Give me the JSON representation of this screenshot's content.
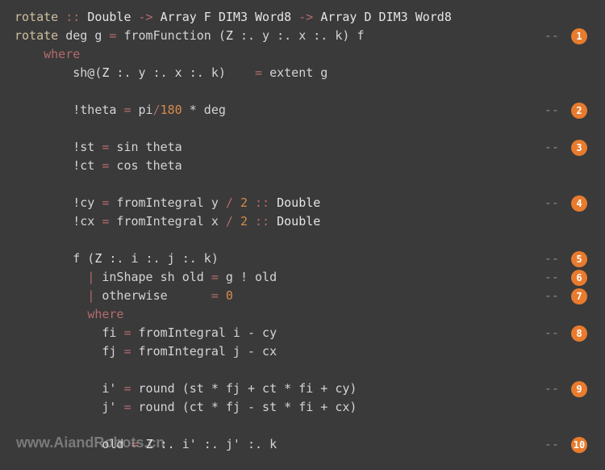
{
  "lines": [
    {
      "tokens": [
        {
          "t": "rotate ",
          "c": "c-fn"
        },
        {
          "t": "::",
          "c": "c-op"
        },
        {
          "t": " ",
          "c": "c-plain"
        },
        {
          "t": "Double",
          "c": "c-type"
        },
        {
          "t": " ",
          "c": "c-plain"
        },
        {
          "t": "->",
          "c": "c-op"
        },
        {
          "t": " ",
          "c": "c-plain"
        },
        {
          "t": "Array F DIM3 Word8",
          "c": "c-type"
        },
        {
          "t": " ",
          "c": "c-plain"
        },
        {
          "t": "->",
          "c": "c-op"
        },
        {
          "t": " ",
          "c": "c-plain"
        },
        {
          "t": "Array D DIM3 Word8",
          "c": "c-type"
        }
      ],
      "marker": null
    },
    {
      "tokens": [
        {
          "t": "rotate",
          "c": "c-fn"
        },
        {
          "t": " deg g ",
          "c": "c-var"
        },
        {
          "t": "=",
          "c": "c-eq"
        },
        {
          "t": " fromFunction (",
          "c": "c-var"
        },
        {
          "t": "Z",
          "c": "c-type"
        },
        {
          "t": " :. y :. x :. k) f",
          "c": "c-var"
        }
      ],
      "marker": "1"
    },
    {
      "tokens": [
        {
          "t": "    ",
          "c": "c-plain"
        },
        {
          "t": "where",
          "c": "c-kw"
        }
      ],
      "marker": null
    },
    {
      "tokens": [
        {
          "t": "        sh@(",
          "c": "c-var"
        },
        {
          "t": "Z",
          "c": "c-type"
        },
        {
          "t": " :. y :. x :. k)    ",
          "c": "c-var"
        },
        {
          "t": "=",
          "c": "c-eq"
        },
        {
          "t": " extent g",
          "c": "c-var"
        }
      ],
      "marker": null
    },
    {
      "tokens": [
        {
          "t": " ",
          "c": "c-plain"
        }
      ],
      "marker": null
    },
    {
      "tokens": [
        {
          "t": "        !theta ",
          "c": "c-var"
        },
        {
          "t": "=",
          "c": "c-eq"
        },
        {
          "t": " pi",
          "c": "c-var"
        },
        {
          "t": "/",
          "c": "c-op"
        },
        {
          "t": "180",
          "c": "c-num"
        },
        {
          "t": " * deg",
          "c": "c-var"
        }
      ],
      "marker": "2"
    },
    {
      "tokens": [
        {
          "t": " ",
          "c": "c-plain"
        }
      ],
      "marker": null
    },
    {
      "tokens": [
        {
          "t": "        !st ",
          "c": "c-var"
        },
        {
          "t": "=",
          "c": "c-eq"
        },
        {
          "t": " sin theta",
          "c": "c-var"
        }
      ],
      "marker": "3"
    },
    {
      "tokens": [
        {
          "t": "        !ct ",
          "c": "c-var"
        },
        {
          "t": "=",
          "c": "c-eq"
        },
        {
          "t": " cos theta",
          "c": "c-var"
        }
      ],
      "marker": null
    },
    {
      "tokens": [
        {
          "t": " ",
          "c": "c-plain"
        }
      ],
      "marker": null
    },
    {
      "tokens": [
        {
          "t": "        !cy ",
          "c": "c-var"
        },
        {
          "t": "=",
          "c": "c-eq"
        },
        {
          "t": " fromIntegral y ",
          "c": "c-var"
        },
        {
          "t": "/",
          "c": "c-op"
        },
        {
          "t": " ",
          "c": "c-plain"
        },
        {
          "t": "2",
          "c": "c-num"
        },
        {
          "t": " ",
          "c": "c-plain"
        },
        {
          "t": "::",
          "c": "c-op"
        },
        {
          "t": " ",
          "c": "c-plain"
        },
        {
          "t": "Double",
          "c": "c-type"
        }
      ],
      "marker": "4"
    },
    {
      "tokens": [
        {
          "t": "        !cx ",
          "c": "c-var"
        },
        {
          "t": "=",
          "c": "c-eq"
        },
        {
          "t": " fromIntegral x ",
          "c": "c-var"
        },
        {
          "t": "/",
          "c": "c-op"
        },
        {
          "t": " ",
          "c": "c-plain"
        },
        {
          "t": "2",
          "c": "c-num"
        },
        {
          "t": " ",
          "c": "c-plain"
        },
        {
          "t": "::",
          "c": "c-op"
        },
        {
          "t": " ",
          "c": "c-plain"
        },
        {
          "t": "Double",
          "c": "c-type"
        }
      ],
      "marker": null
    },
    {
      "tokens": [
        {
          "t": " ",
          "c": "c-plain"
        }
      ],
      "marker": null
    },
    {
      "tokens": [
        {
          "t": "        f (",
          "c": "c-var"
        },
        {
          "t": "Z",
          "c": "c-type"
        },
        {
          "t": " :. i :. j :. k)",
          "c": "c-var"
        }
      ],
      "marker": "5"
    },
    {
      "tokens": [
        {
          "t": "          ",
          "c": "c-plain"
        },
        {
          "t": "|",
          "c": "c-op"
        },
        {
          "t": " inShape sh old ",
          "c": "c-var"
        },
        {
          "t": "=",
          "c": "c-eq"
        },
        {
          "t": " g ! old",
          "c": "c-var"
        }
      ],
      "marker": "6"
    },
    {
      "tokens": [
        {
          "t": "          ",
          "c": "c-plain"
        },
        {
          "t": "|",
          "c": "c-op"
        },
        {
          "t": " otherwise      ",
          "c": "c-var"
        },
        {
          "t": "=",
          "c": "c-eq"
        },
        {
          "t": " ",
          "c": "c-plain"
        },
        {
          "t": "0",
          "c": "c-num"
        }
      ],
      "marker": "7"
    },
    {
      "tokens": [
        {
          "t": "          ",
          "c": "c-plain"
        },
        {
          "t": "where",
          "c": "c-kw"
        }
      ],
      "marker": null
    },
    {
      "tokens": [
        {
          "t": "            fi ",
          "c": "c-var"
        },
        {
          "t": "=",
          "c": "c-eq"
        },
        {
          "t": " fromIntegral i - cy",
          "c": "c-var"
        }
      ],
      "marker": "8"
    },
    {
      "tokens": [
        {
          "t": "            fj ",
          "c": "c-var"
        },
        {
          "t": "=",
          "c": "c-eq"
        },
        {
          "t": " fromIntegral j - cx",
          "c": "c-var"
        }
      ],
      "marker": null
    },
    {
      "tokens": [
        {
          "t": " ",
          "c": "c-plain"
        }
      ],
      "marker": null
    },
    {
      "tokens": [
        {
          "t": "            i' ",
          "c": "c-var"
        },
        {
          "t": "=",
          "c": "c-eq"
        },
        {
          "t": " round (st * fj + ct * fi + cy)",
          "c": "c-var"
        }
      ],
      "marker": "9"
    },
    {
      "tokens": [
        {
          "t": "            j' ",
          "c": "c-var"
        },
        {
          "t": "=",
          "c": "c-eq"
        },
        {
          "t": " round (ct * fj - st * fi + cx)",
          "c": "c-var"
        }
      ],
      "marker": null
    },
    {
      "tokens": [
        {
          "t": " ",
          "c": "c-plain"
        }
      ],
      "marker": null
    },
    {
      "tokens": [
        {
          "t": "            old ",
          "c": "c-var"
        },
        {
          "t": "=",
          "c": "c-eq"
        },
        {
          "t": " ",
          "c": "c-plain"
        },
        {
          "t": "Z",
          "c": "c-type"
        },
        {
          "t": " :. i' :. j' :. k",
          "c": "c-var"
        }
      ],
      "marker": "10"
    }
  ],
  "watermark": "www.AiandRobots.cn",
  "marker_prefix": "-- "
}
